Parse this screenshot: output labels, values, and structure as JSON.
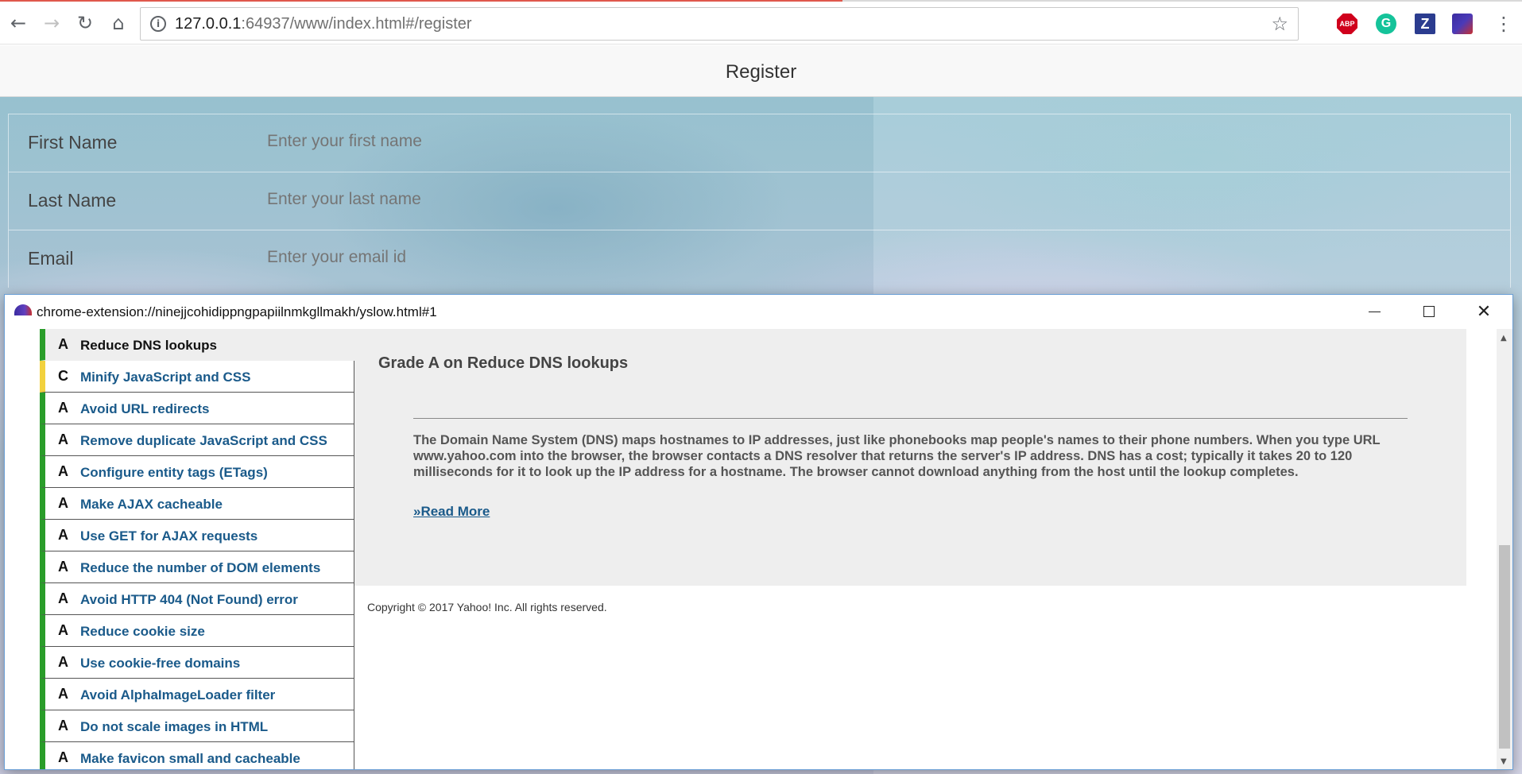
{
  "browser": {
    "url_host": "127.0.0.1",
    "url_rest": ":64937/www/index.html#/register",
    "extensions": [
      "ABP",
      "G",
      "Z",
      ""
    ]
  },
  "page": {
    "title": "Register",
    "form": [
      {
        "label": "First Name",
        "placeholder": "Enter your first name"
      },
      {
        "label": "Last Name",
        "placeholder": "Enter your last name"
      },
      {
        "label": "Email",
        "placeholder": "Enter your email id"
      }
    ]
  },
  "popup": {
    "title": "chrome-extension://ninejjcohidippngpapiilnmkgllmakh/yslow.html#1",
    "rules": [
      {
        "grade": "A",
        "name": "Reduce DNS lookups",
        "status": "pass",
        "selected": true
      },
      {
        "grade": "C",
        "name": "Minify JavaScript and CSS",
        "status": "warn"
      },
      {
        "grade": "A",
        "name": "Avoid URL redirects",
        "status": "pass"
      },
      {
        "grade": "A",
        "name": "Remove duplicate JavaScript and CSS",
        "status": "pass"
      },
      {
        "grade": "A",
        "name": "Configure entity tags (ETags)",
        "status": "pass"
      },
      {
        "grade": "A",
        "name": "Make AJAX cacheable",
        "status": "pass"
      },
      {
        "grade": "A",
        "name": "Use GET for AJAX requests",
        "status": "pass"
      },
      {
        "grade": "A",
        "name": "Reduce the number of DOM elements",
        "status": "pass"
      },
      {
        "grade": "A",
        "name": "Avoid HTTP 404 (Not Found) error",
        "status": "pass"
      },
      {
        "grade": "A",
        "name": "Reduce cookie size",
        "status": "pass"
      },
      {
        "grade": "A",
        "name": "Use cookie-free domains",
        "status": "pass"
      },
      {
        "grade": "A",
        "name": "Avoid AlphaImageLoader filter",
        "status": "pass"
      },
      {
        "grade": "A",
        "name": "Do not scale images in HTML",
        "status": "pass"
      },
      {
        "grade": "A",
        "name": "Make favicon small and cacheable",
        "status": "pass"
      }
    ],
    "detail": {
      "heading": "Grade A on Reduce DNS lookups",
      "description": "The Domain Name System (DNS) maps hostnames to IP addresses, just like phonebooks map people's names to their phone numbers. When you type URL www.yahoo.com into the browser, the browser contacts a DNS resolver that returns the server's IP address. DNS has a cost; typically it takes 20 to 120 milliseconds for it to look up the IP address for a hostname. The browser cannot download anything from the host until the lookup completes.",
      "read_more": "»Read More"
    },
    "copyright": "Copyright © 2017 Yahoo! Inc. All rights reserved."
  },
  "colors": {
    "pass": "#2a9d2a",
    "warn": "#f2d13e",
    "link": "#1a5a8a"
  }
}
